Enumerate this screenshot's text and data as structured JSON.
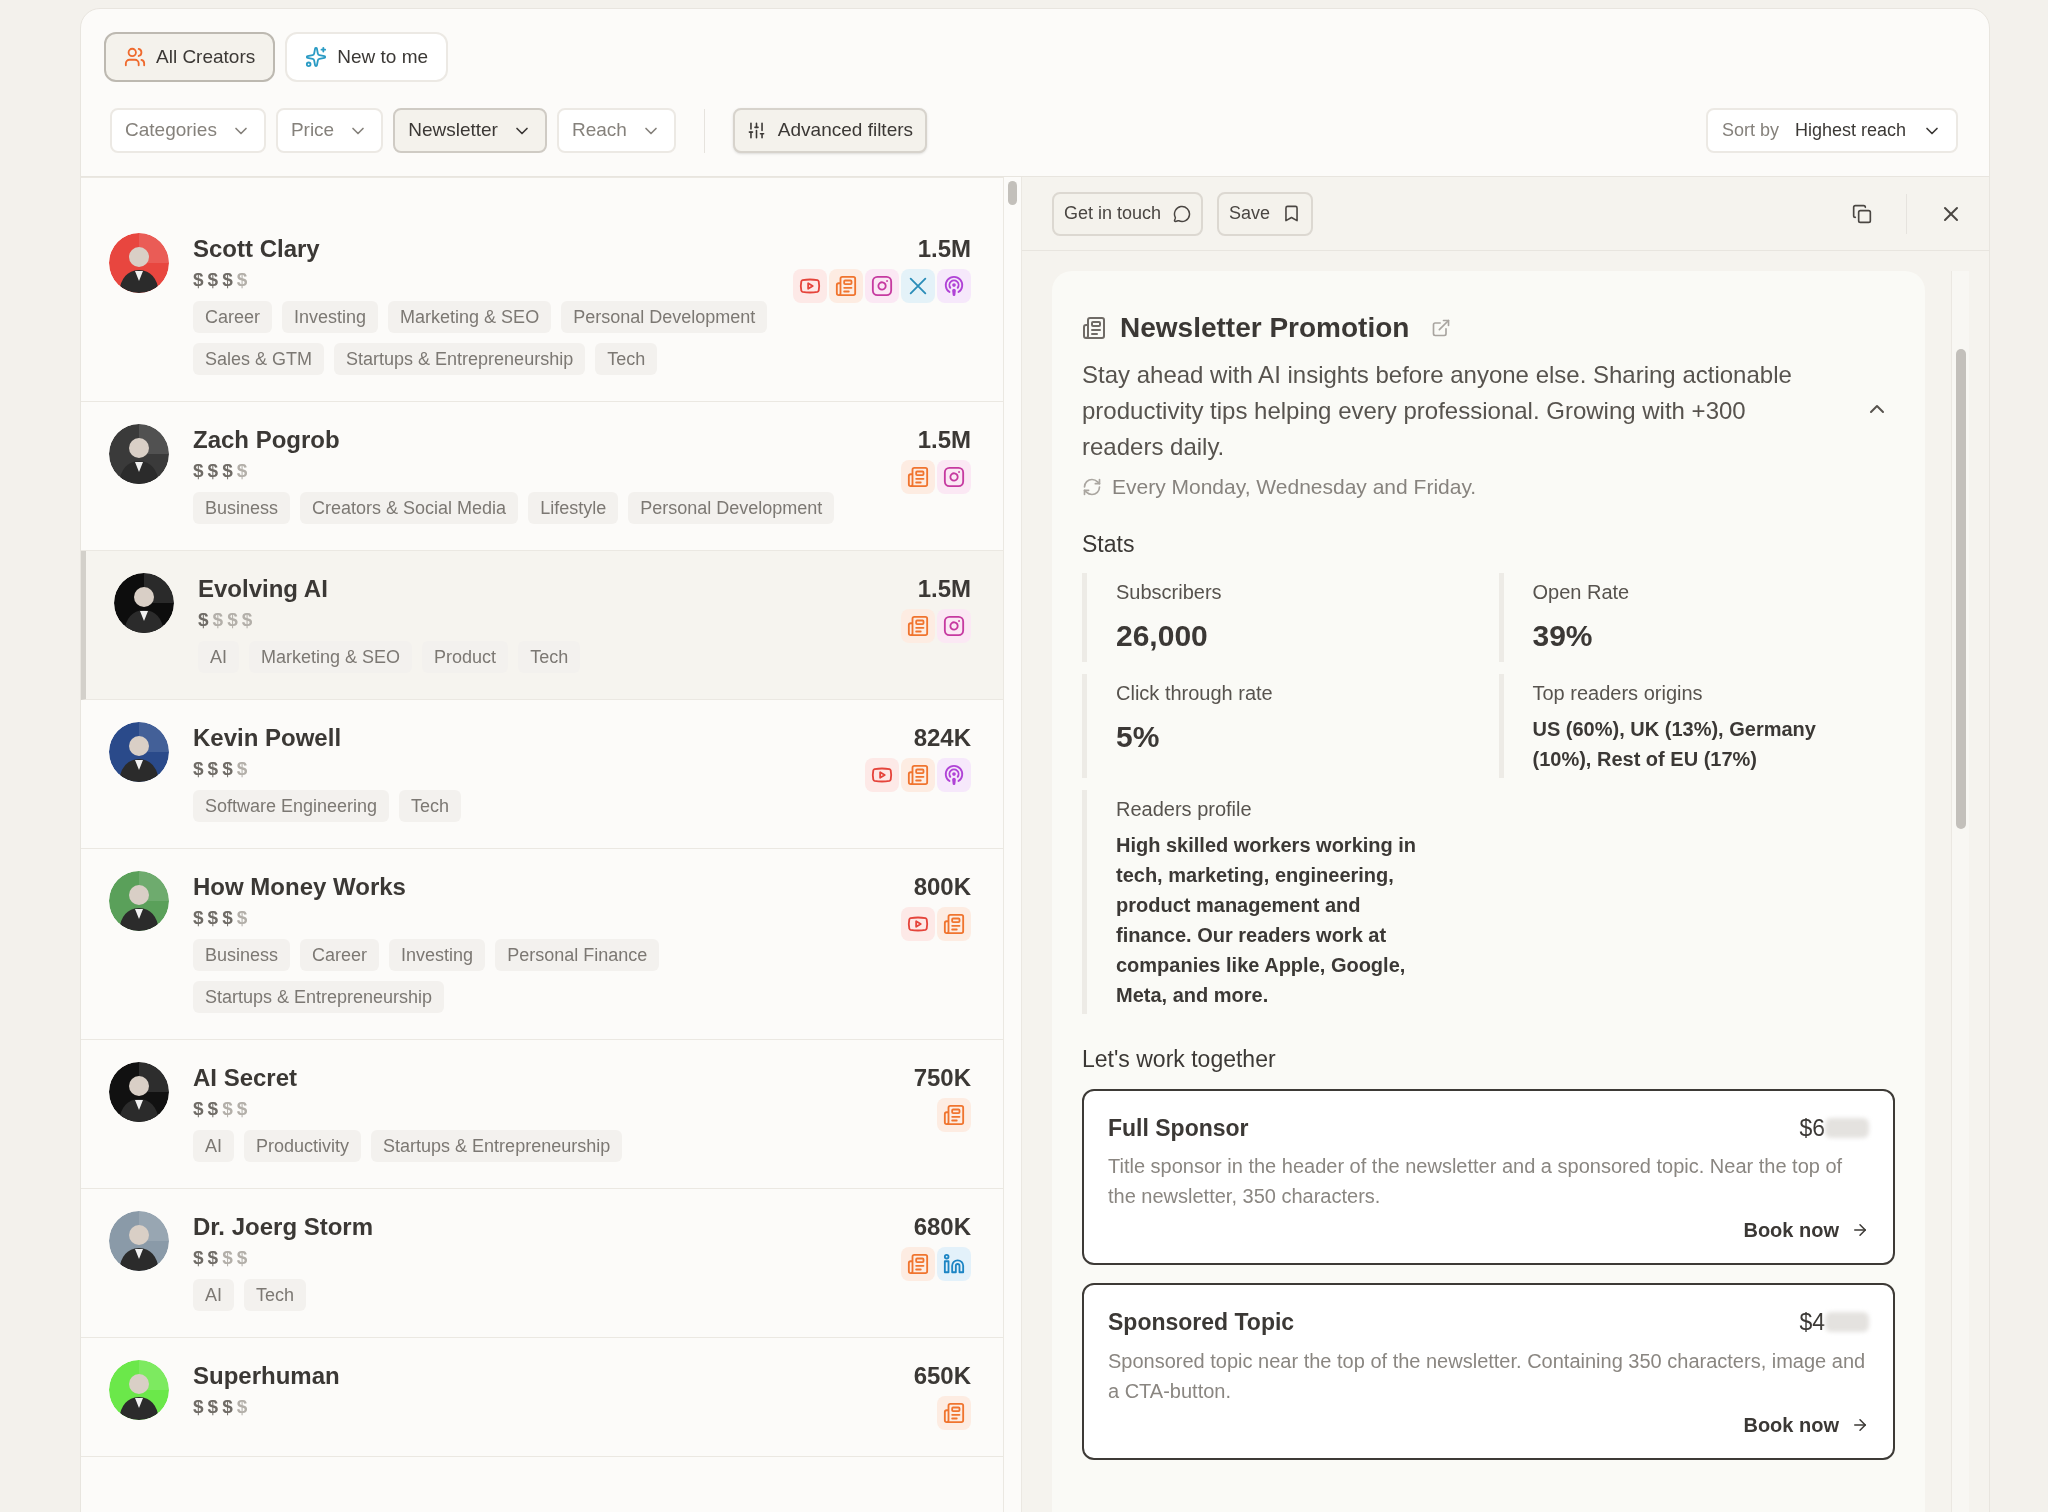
{
  "tabs": [
    {
      "label": "All Creators",
      "selected": true,
      "kind": "users"
    },
    {
      "label": "New to me",
      "selected": false,
      "kind": "sparkles"
    }
  ],
  "filters": [
    {
      "label": "Categories",
      "selected": false
    },
    {
      "label": "Price",
      "selected": false
    },
    {
      "label": "Newsletter",
      "selected": true
    },
    {
      "label": "Reach",
      "selected": false
    }
  ],
  "advanced_filters": {
    "label": "Advanced filters"
  },
  "sort": {
    "label": "Sort by",
    "value": "Highest reach"
  },
  "creators": [
    {
      "name": "Scott Clary",
      "selected": false,
      "price": [
        {
          "text": "$",
          "on": true
        },
        {
          "text": "$",
          "on": true
        },
        {
          "text": "$",
          "on": true
        },
        {
          "text": "$",
          "on": false
        }
      ],
      "reach": "1.5M",
      "platforms": [
        {
          "kind": "youtube"
        },
        {
          "kind": "newsletter"
        },
        {
          "kind": "instagram"
        },
        {
          "kind": "x"
        },
        {
          "kind": "podcast"
        }
      ],
      "tags": [
        "Career",
        "Investing",
        "Marketing & SEO",
        "Personal Development",
        "Sales & GTM",
        "Startups & Entrepreneurship",
        "Tech"
      ]
    },
    {
      "name": "Zach Pogrob",
      "selected": false,
      "price": [
        {
          "text": "$",
          "on": true
        },
        {
          "text": "$",
          "on": true
        },
        {
          "text": "$",
          "on": true
        },
        {
          "text": "$",
          "on": false
        }
      ],
      "reach": "1.5M",
      "platforms": [
        {
          "kind": "newsletter"
        },
        {
          "kind": "instagram"
        }
      ],
      "tags": [
        "Business",
        "Creators & Social Media",
        "Lifestyle",
        "Personal Development"
      ]
    },
    {
      "name": "Evolving AI",
      "selected": true,
      "price": [
        {
          "text": "$",
          "on": true
        },
        {
          "text": "$",
          "on": false
        },
        {
          "text": "$",
          "on": false
        },
        {
          "text": "$",
          "on": false
        }
      ],
      "reach": "1.5M",
      "platforms": [
        {
          "kind": "newsletter"
        },
        {
          "kind": "instagram"
        }
      ],
      "tags": [
        "AI",
        "Marketing & SEO",
        "Product",
        "Tech"
      ]
    },
    {
      "name": "Kevin Powell",
      "selected": false,
      "price": [
        {
          "text": "$",
          "on": true
        },
        {
          "text": "$",
          "on": true
        },
        {
          "text": "$",
          "on": true
        },
        {
          "text": "$",
          "on": false
        }
      ],
      "reach": "824K",
      "platforms": [
        {
          "kind": "youtube"
        },
        {
          "kind": "newsletter"
        },
        {
          "kind": "podcast"
        }
      ],
      "tags": [
        "Software Engineering",
        "Tech"
      ]
    },
    {
      "name": "How Money Works",
      "selected": false,
      "price": [
        {
          "text": "$",
          "on": true
        },
        {
          "text": "$",
          "on": true
        },
        {
          "text": "$",
          "on": true
        },
        {
          "text": "$",
          "on": false
        }
      ],
      "reach": "800K",
      "platforms": [
        {
          "kind": "youtube"
        },
        {
          "kind": "newsletter"
        }
      ],
      "tags": [
        "Business",
        "Career",
        "Investing",
        "Personal Finance",
        "Startups & Entrepreneurship"
      ]
    },
    {
      "name": "AI Secret",
      "selected": false,
      "price": [
        {
          "text": "$",
          "on": true
        },
        {
          "text": "$",
          "on": true
        },
        {
          "text": "$",
          "on": false
        },
        {
          "text": "$",
          "on": false
        }
      ],
      "reach": "750K",
      "platforms": [
        {
          "kind": "newsletter"
        }
      ],
      "tags": [
        "AI",
        "Productivity",
        "Startups & Entrepreneurship"
      ]
    },
    {
      "name": "Dr. Joerg Storm",
      "selected": false,
      "price": [
        {
          "text": "$",
          "on": true
        },
        {
          "text": "$",
          "on": true
        },
        {
          "text": "$",
          "on": false
        },
        {
          "text": "$",
          "on": false
        }
      ],
      "reach": "680K",
      "platforms": [
        {
          "kind": "newsletter"
        },
        {
          "kind": "linkedin"
        }
      ],
      "tags": [
        "AI",
        "Tech"
      ]
    },
    {
      "name": "Superhuman",
      "selected": false,
      "price": [
        {
          "text": "$",
          "on": true
        },
        {
          "text": "$",
          "on": true
        },
        {
          "text": "$",
          "on": true
        },
        {
          "text": "$",
          "on": false
        }
      ],
      "reach": "650K",
      "platforms": [
        {
          "kind": "newsletter"
        }
      ]
    }
  ],
  "detail": {
    "actions": [
      {
        "label": "Get in touch",
        "kind": "message"
      },
      {
        "label": "Save",
        "kind": "bookmark"
      }
    ],
    "title": "Newsletter Promotion",
    "description": "Stay ahead with AI insights before anyone else. Sharing actionable productivity tips helping every professional. Growing with +300 readers daily.",
    "expanded": true,
    "schedule": "Every Monday, Wednesday and Friday.",
    "stats_title": "Stats",
    "stats": [
      {
        "label": "Subscribers",
        "value": "26,000",
        "kind": "number"
      },
      {
        "label": "Open Rate",
        "value": "39%",
        "kind": "number"
      },
      {
        "label": "Click through rate",
        "value": "5%",
        "kind": "number"
      },
      {
        "label": "Top readers origins",
        "value": "US (60%), UK (13%), Germany (10%), Rest of EU (17%)",
        "kind": "text"
      },
      {
        "label": "Readers profile",
        "value": "High skilled workers working in tech, marketing, engineering, product management and finance. Our readers work at companies like Apple, Google, Meta, and more.",
        "kind": "text"
      }
    ],
    "work_title": "Let's work together",
    "offers": [
      {
        "title": "Full Sponsor",
        "price": "$6",
        "description": "Title sponsor in the header of the newsletter and a sponsored topic. Near the top of the newsletter, 350 characters.",
        "action": "Book now"
      },
      {
        "title": "Sponsored Topic",
        "price": "$4",
        "description": "Sponsored topic near the top of the newsletter. Containing 350 characters, image and a CTA-button.",
        "action": "Book now"
      }
    ]
  }
}
